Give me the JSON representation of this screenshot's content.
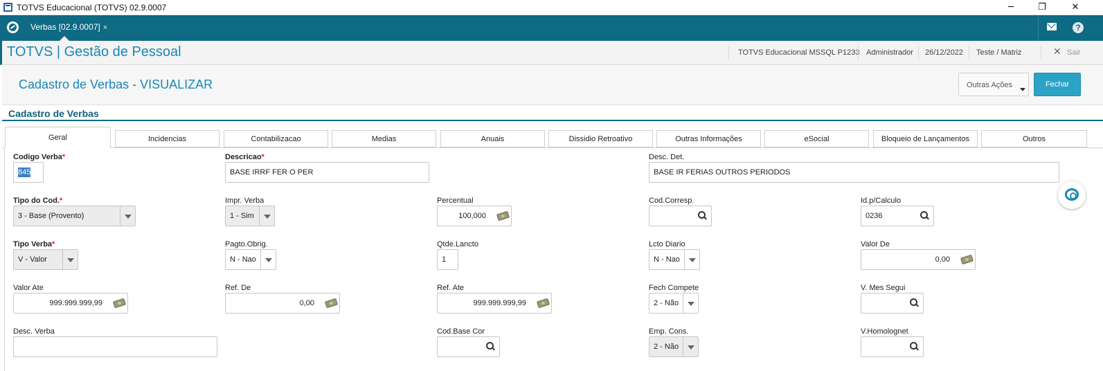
{
  "window": {
    "title": "TOTVS Educacional (TOTVS) 02.9.0007",
    "controls": {
      "minimize": "─",
      "restore": "❐",
      "close": "✕"
    }
  },
  "tabbar": {
    "tab_label": "Verbas [02.9.0007]",
    "tab_close": "×",
    "icons": [
      "totvs-logo-icon",
      "mail-icon",
      "help-icon"
    ],
    "help_glyph": "?"
  },
  "app_header": {
    "app_title": "TOTVS | Gestão de Pessoal",
    "database": "TOTVS Educacional MSSQL P1233",
    "user": "Administrador",
    "date": "26/12/2022",
    "company": "Teste / Matriz",
    "exit_glyph": "✕",
    "exit_label": "Sair"
  },
  "page": {
    "title": "Cadastro de Verbas - VISUALIZAR",
    "more_actions_label": "Outras Ações",
    "close_label": "Fechar",
    "section_title": "Cadastro de Verbas"
  },
  "tabs": [
    {
      "label": "Geral",
      "active": true
    },
    {
      "label": "Incidencias"
    },
    {
      "label": "Contabilizacao"
    },
    {
      "label": "Medias"
    },
    {
      "label": "Anuais"
    },
    {
      "label": "Dissidio Retroativo"
    },
    {
      "label": "Outras Informações"
    },
    {
      "label": "eSocial"
    },
    {
      "label": "Bloqueio de Lançamentos"
    },
    {
      "label": "Outros"
    }
  ],
  "fields": {
    "codigo_verba": {
      "label": "Codigo Verba",
      "required_mark": "*",
      "value": "845"
    },
    "descricao": {
      "label": "Descricao",
      "required_mark": "*",
      "value": "BASE IRRF FER O PER"
    },
    "desc_det": {
      "label": "Desc. Det.",
      "value": "BASE IR FERIAS OUTROS PERIODOS"
    },
    "tipo_cod": {
      "label": "Tipo do Cod.",
      "required_mark": "*",
      "value": "3 - Base (Provento)"
    },
    "impr_verba": {
      "label": "Impr. Verba",
      "value": "1 - Sim"
    },
    "percentual": {
      "label": "Percentual",
      "value": "100,000"
    },
    "cod_corresp": {
      "label": "Cod.Corresp.",
      "value": ""
    },
    "id_calculo": {
      "label": "Id.p/Calculo",
      "value": "0236"
    },
    "tipo_verba": {
      "label": "Tipo Verba",
      "required_mark": "*",
      "value": "V - Valor"
    },
    "pagto_obrig": {
      "label": "Pagto.Obrig.",
      "value": "N - Nao"
    },
    "qtde_lancto": {
      "label": "Qtde.Lancto",
      "value": "1"
    },
    "lcto_diario": {
      "label": "Lcto Diario",
      "value": "N - Nao"
    },
    "valor_de": {
      "label": "Valor De",
      "value": "0,00"
    },
    "valor_ate": {
      "label": "Valor Ate",
      "value": "999.999.999,99"
    },
    "ref_de": {
      "label": "Ref. De",
      "value": "0,00"
    },
    "ref_ate": {
      "label": "Ref. Ate",
      "value": "999.999.999,99"
    },
    "fech_compete": {
      "label": "Fech Compete",
      "value": "2 - Não"
    },
    "v_mes_segui": {
      "label": "V. Mes Segui",
      "value": ""
    },
    "desc_verba": {
      "label": "Desc. Verba",
      "value": ""
    },
    "cod_base_cor": {
      "label": "Cod.Base Cor",
      "value": ""
    },
    "emp_cons": {
      "label": "Emp. Cons.",
      "value": "2 - Não"
    },
    "v_homolognet": {
      "label": "V.Homolognet",
      "value": ""
    }
  }
}
